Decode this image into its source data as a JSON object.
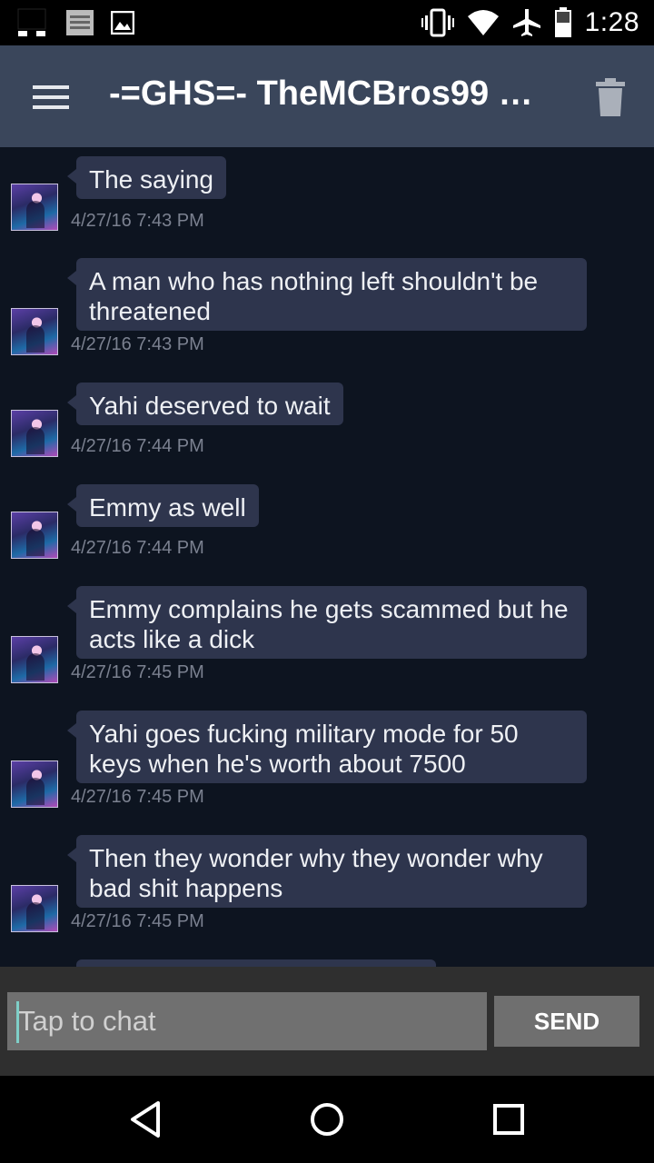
{
  "status_bar": {
    "time": "1:28",
    "left_icons": [
      "notification-blocks-icon",
      "news-icon",
      "image-icon"
    ],
    "right_icons": [
      "vibrate-icon",
      "wifi-icon",
      "airplane-icon",
      "battery-icon"
    ]
  },
  "toolbar": {
    "title": "-=GHS=- TheMCBros99 #...",
    "menu_icon": "hamburger-menu-icon",
    "delete_icon": "trash-icon"
  },
  "messages": [
    {
      "text": "The saying",
      "timestamp": "4/27/16 7:43 PM"
    },
    {
      "text": "A man who has nothing left shouldn't be threatened",
      "timestamp": "4/27/16 7:43 PM"
    },
    {
      "text": "Yahi deserved to wait",
      "timestamp": "4/27/16 7:44 PM"
    },
    {
      "text": "Emmy as well",
      "timestamp": "4/27/16 7:44 PM"
    },
    {
      "text": "Emmy complains he gets scammed but he acts like a dick",
      "timestamp": "4/27/16 7:45 PM"
    },
    {
      "text": "Yahi goes fucking military mode for 50 keys when he's worth about 7500",
      "timestamp": "4/27/16 7:45 PM"
    },
    {
      "text": "Then they wonder why they wonder why bad shit happens",
      "timestamp": "4/27/16 7:45 PM"
    }
  ],
  "input": {
    "placeholder": "Tap to chat",
    "send_label": "SEND"
  },
  "colors": {
    "toolbar": "#3a465b",
    "chat_background": "#0d1420",
    "bubble": "#2e354d",
    "timestamp": "#7b8190"
  }
}
